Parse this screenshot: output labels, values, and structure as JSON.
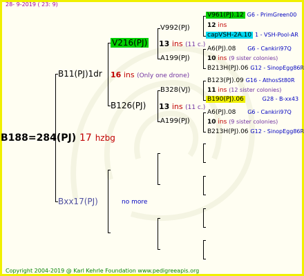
{
  "date": "28-  9-2019  ( 23:  9)",
  "footer": "Copyright 2004-2019 @ Karl Kehrle Foundation     www.pedigreeapis.org",
  "root": {
    "id": "B188=284(PJ)",
    "num": "17",
    "note": "hzbg"
  },
  "gen2": [
    {
      "id": "B11(PJ)1dr",
      "num": "16",
      "note": "ins",
      "note2": "(Only one drone)"
    },
    {
      "id": "Bxx17(PJ)",
      "note": "no more"
    }
  ],
  "gen3": [
    {
      "id": "V216(PJ)",
      "num": "13",
      "note": "ins",
      "note2": "(11 c.)"
    },
    {
      "id": "B126(PJ)",
      "num": "13",
      "note": "ins",
      "note2": "(11 c.)"
    }
  ],
  "gen4": [
    {
      "id": "V992(PJ)"
    },
    {
      "id": "A199(PJ)"
    },
    {
      "id": "B328(VJ)"
    },
    {
      "id": "A199(PJ)"
    }
  ],
  "gen5": [
    {
      "id": "V961(PJ).12",
      "info": "G6 - PrimGreen00"
    },
    {
      "num": "12",
      "note": "ins"
    },
    {
      "id": "capVSH-2A.10",
      "info": "1 - VSH-Pool-AR"
    },
    {
      "id": "A6(PJ).08",
      "info": "G6 - Cankiri97Q"
    },
    {
      "num": "10",
      "note": "ins",
      "note2": "(9 sister colonies)"
    },
    {
      "id": "B213H(PJ).06",
      "info": "G12 - SinopEgg86R"
    },
    {
      "id": "B123(PJ).09",
      "info": "G16 - AthosSt80R"
    },
    {
      "num": "11",
      "note": "ins",
      "note2": "(12 sister colonies)"
    },
    {
      "id": "B190(PJ).06",
      "info": "G28 - B-xx43"
    },
    {
      "id": "A6(PJ).08",
      "info": "G6 - Cankiri97Q"
    },
    {
      "num": "10",
      "note": "ins",
      "note2": "(9 sister colonies)"
    },
    {
      "id": "B213H(PJ).06",
      "info": "G12 - SinopEgg86R"
    }
  ],
  "colors": {
    "frame": "#f0f000",
    "green": "#00d000",
    "cyan": "#00d8f0",
    "yellow": "#f0f000"
  }
}
